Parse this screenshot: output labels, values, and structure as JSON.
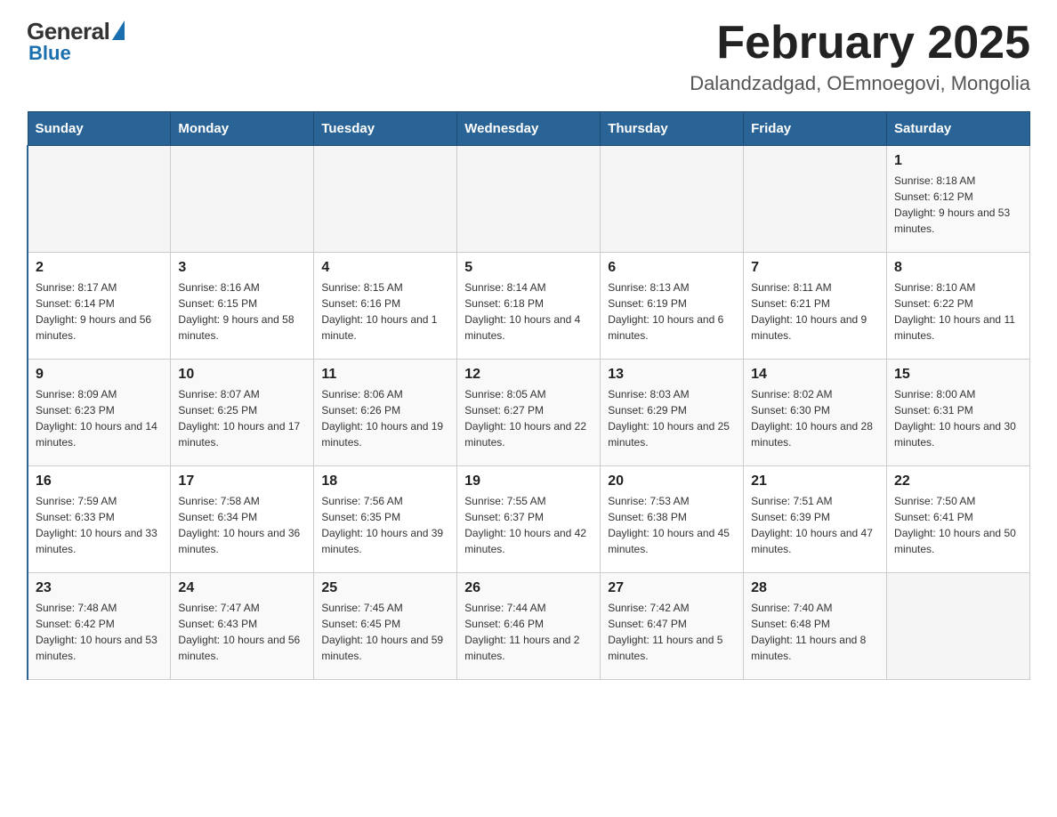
{
  "header": {
    "logo_general": "General",
    "logo_blue": "Blue",
    "title": "February 2025",
    "subtitle": "Dalandzadgad, OEmnoegovi, Mongolia"
  },
  "days_of_week": [
    "Sunday",
    "Monday",
    "Tuesday",
    "Wednesday",
    "Thursday",
    "Friday",
    "Saturday"
  ],
  "weeks": [
    [
      {
        "day": "",
        "info": ""
      },
      {
        "day": "",
        "info": ""
      },
      {
        "day": "",
        "info": ""
      },
      {
        "day": "",
        "info": ""
      },
      {
        "day": "",
        "info": ""
      },
      {
        "day": "",
        "info": ""
      },
      {
        "day": "1",
        "info": "Sunrise: 8:18 AM\nSunset: 6:12 PM\nDaylight: 9 hours and 53 minutes."
      }
    ],
    [
      {
        "day": "2",
        "info": "Sunrise: 8:17 AM\nSunset: 6:14 PM\nDaylight: 9 hours and 56 minutes."
      },
      {
        "day": "3",
        "info": "Sunrise: 8:16 AM\nSunset: 6:15 PM\nDaylight: 9 hours and 58 minutes."
      },
      {
        "day": "4",
        "info": "Sunrise: 8:15 AM\nSunset: 6:16 PM\nDaylight: 10 hours and 1 minute."
      },
      {
        "day": "5",
        "info": "Sunrise: 8:14 AM\nSunset: 6:18 PM\nDaylight: 10 hours and 4 minutes."
      },
      {
        "day": "6",
        "info": "Sunrise: 8:13 AM\nSunset: 6:19 PM\nDaylight: 10 hours and 6 minutes."
      },
      {
        "day": "7",
        "info": "Sunrise: 8:11 AM\nSunset: 6:21 PM\nDaylight: 10 hours and 9 minutes."
      },
      {
        "day": "8",
        "info": "Sunrise: 8:10 AM\nSunset: 6:22 PM\nDaylight: 10 hours and 11 minutes."
      }
    ],
    [
      {
        "day": "9",
        "info": "Sunrise: 8:09 AM\nSunset: 6:23 PM\nDaylight: 10 hours and 14 minutes."
      },
      {
        "day": "10",
        "info": "Sunrise: 8:07 AM\nSunset: 6:25 PM\nDaylight: 10 hours and 17 minutes."
      },
      {
        "day": "11",
        "info": "Sunrise: 8:06 AM\nSunset: 6:26 PM\nDaylight: 10 hours and 19 minutes."
      },
      {
        "day": "12",
        "info": "Sunrise: 8:05 AM\nSunset: 6:27 PM\nDaylight: 10 hours and 22 minutes."
      },
      {
        "day": "13",
        "info": "Sunrise: 8:03 AM\nSunset: 6:29 PM\nDaylight: 10 hours and 25 minutes."
      },
      {
        "day": "14",
        "info": "Sunrise: 8:02 AM\nSunset: 6:30 PM\nDaylight: 10 hours and 28 minutes."
      },
      {
        "day": "15",
        "info": "Sunrise: 8:00 AM\nSunset: 6:31 PM\nDaylight: 10 hours and 30 minutes."
      }
    ],
    [
      {
        "day": "16",
        "info": "Sunrise: 7:59 AM\nSunset: 6:33 PM\nDaylight: 10 hours and 33 minutes."
      },
      {
        "day": "17",
        "info": "Sunrise: 7:58 AM\nSunset: 6:34 PM\nDaylight: 10 hours and 36 minutes."
      },
      {
        "day": "18",
        "info": "Sunrise: 7:56 AM\nSunset: 6:35 PM\nDaylight: 10 hours and 39 minutes."
      },
      {
        "day": "19",
        "info": "Sunrise: 7:55 AM\nSunset: 6:37 PM\nDaylight: 10 hours and 42 minutes."
      },
      {
        "day": "20",
        "info": "Sunrise: 7:53 AM\nSunset: 6:38 PM\nDaylight: 10 hours and 45 minutes."
      },
      {
        "day": "21",
        "info": "Sunrise: 7:51 AM\nSunset: 6:39 PM\nDaylight: 10 hours and 47 minutes."
      },
      {
        "day": "22",
        "info": "Sunrise: 7:50 AM\nSunset: 6:41 PM\nDaylight: 10 hours and 50 minutes."
      }
    ],
    [
      {
        "day": "23",
        "info": "Sunrise: 7:48 AM\nSunset: 6:42 PM\nDaylight: 10 hours and 53 minutes."
      },
      {
        "day": "24",
        "info": "Sunrise: 7:47 AM\nSunset: 6:43 PM\nDaylight: 10 hours and 56 minutes."
      },
      {
        "day": "25",
        "info": "Sunrise: 7:45 AM\nSunset: 6:45 PM\nDaylight: 10 hours and 59 minutes."
      },
      {
        "day": "26",
        "info": "Sunrise: 7:44 AM\nSunset: 6:46 PM\nDaylight: 11 hours and 2 minutes."
      },
      {
        "day": "27",
        "info": "Sunrise: 7:42 AM\nSunset: 6:47 PM\nDaylight: 11 hours and 5 minutes."
      },
      {
        "day": "28",
        "info": "Sunrise: 7:40 AM\nSunset: 6:48 PM\nDaylight: 11 hours and 8 minutes."
      },
      {
        "day": "",
        "info": ""
      }
    ]
  ]
}
